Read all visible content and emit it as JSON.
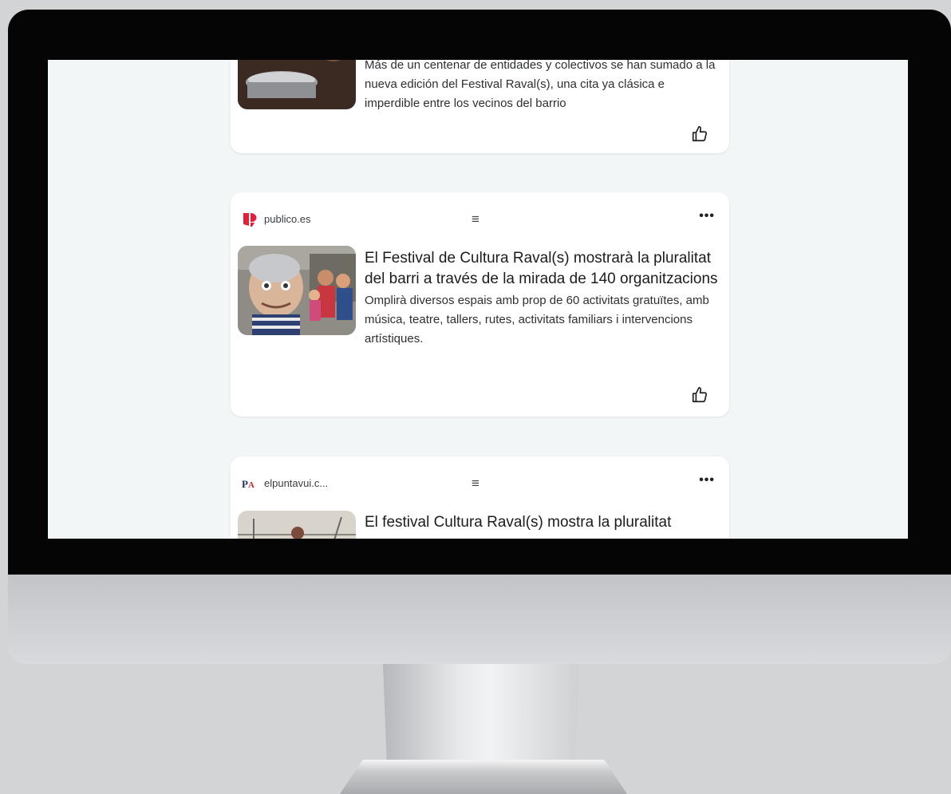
{
  "feed": {
    "items": [
      {
        "summary": "Más de un centenar de entidades y colectivos se han sumado a la nueva edición del Festival Raval(s), una cita ya clásica e imperdible entre los vecinos del barrio"
      },
      {
        "source": "publico.es",
        "headline": "El Festival de Cultura Raval(s) mostrarà la pluralitat del barri a través de la mirada de 140 organitzacions",
        "summary": "Omplirà diversos espais amb prop de 60 activitats gratuïtes, amb música, teatre, tallers, rutes, activitats familiars i intervencions artístiques."
      },
      {
        "source": "elpuntavui.c...",
        "headline": "El festival Cultura Raval(s) mostra la pluralitat"
      }
    ],
    "menu_glyph": "≡",
    "more_glyph": "•••",
    "icons": {
      "like": "thumbs-up-icon",
      "menu": "menu-lines-icon",
      "more": "more-dots-icon"
    },
    "colors": {
      "publico_brand": "#e2203a",
      "background": "#f2f6f7",
      "card": "#ffffff"
    }
  }
}
